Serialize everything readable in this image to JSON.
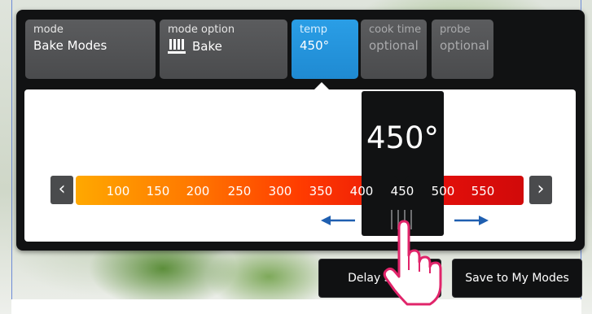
{
  "tabs": [
    {
      "label": "mode",
      "value": "Bake Modes"
    },
    {
      "label": "mode option",
      "value": "Bake",
      "icon": "bake-element-icon"
    },
    {
      "label": "temp",
      "value": "450°",
      "active": true
    },
    {
      "label": "cook time",
      "value": "optional"
    },
    {
      "label": "probe",
      "value": "optional"
    }
  ],
  "temperature": {
    "selected": "450°",
    "scale_labels": [
      "100",
      "150",
      "200",
      "250",
      "300",
      "350",
      "400",
      "450",
      "500",
      "550"
    ],
    "prev_icon": "chevron-left-icon",
    "next_icon": "chevron-right-icon"
  },
  "buttons": {
    "delay_start": "Delay Start",
    "save_to_my_modes": "Save to My Modes"
  },
  "colors": {
    "active_tab": "#2a9ee6",
    "scale_start": "#ffa800",
    "scale_end": "#d10a0a",
    "hint_arrows": "#1f5fb0",
    "hand_outline": "#e0246a"
  }
}
